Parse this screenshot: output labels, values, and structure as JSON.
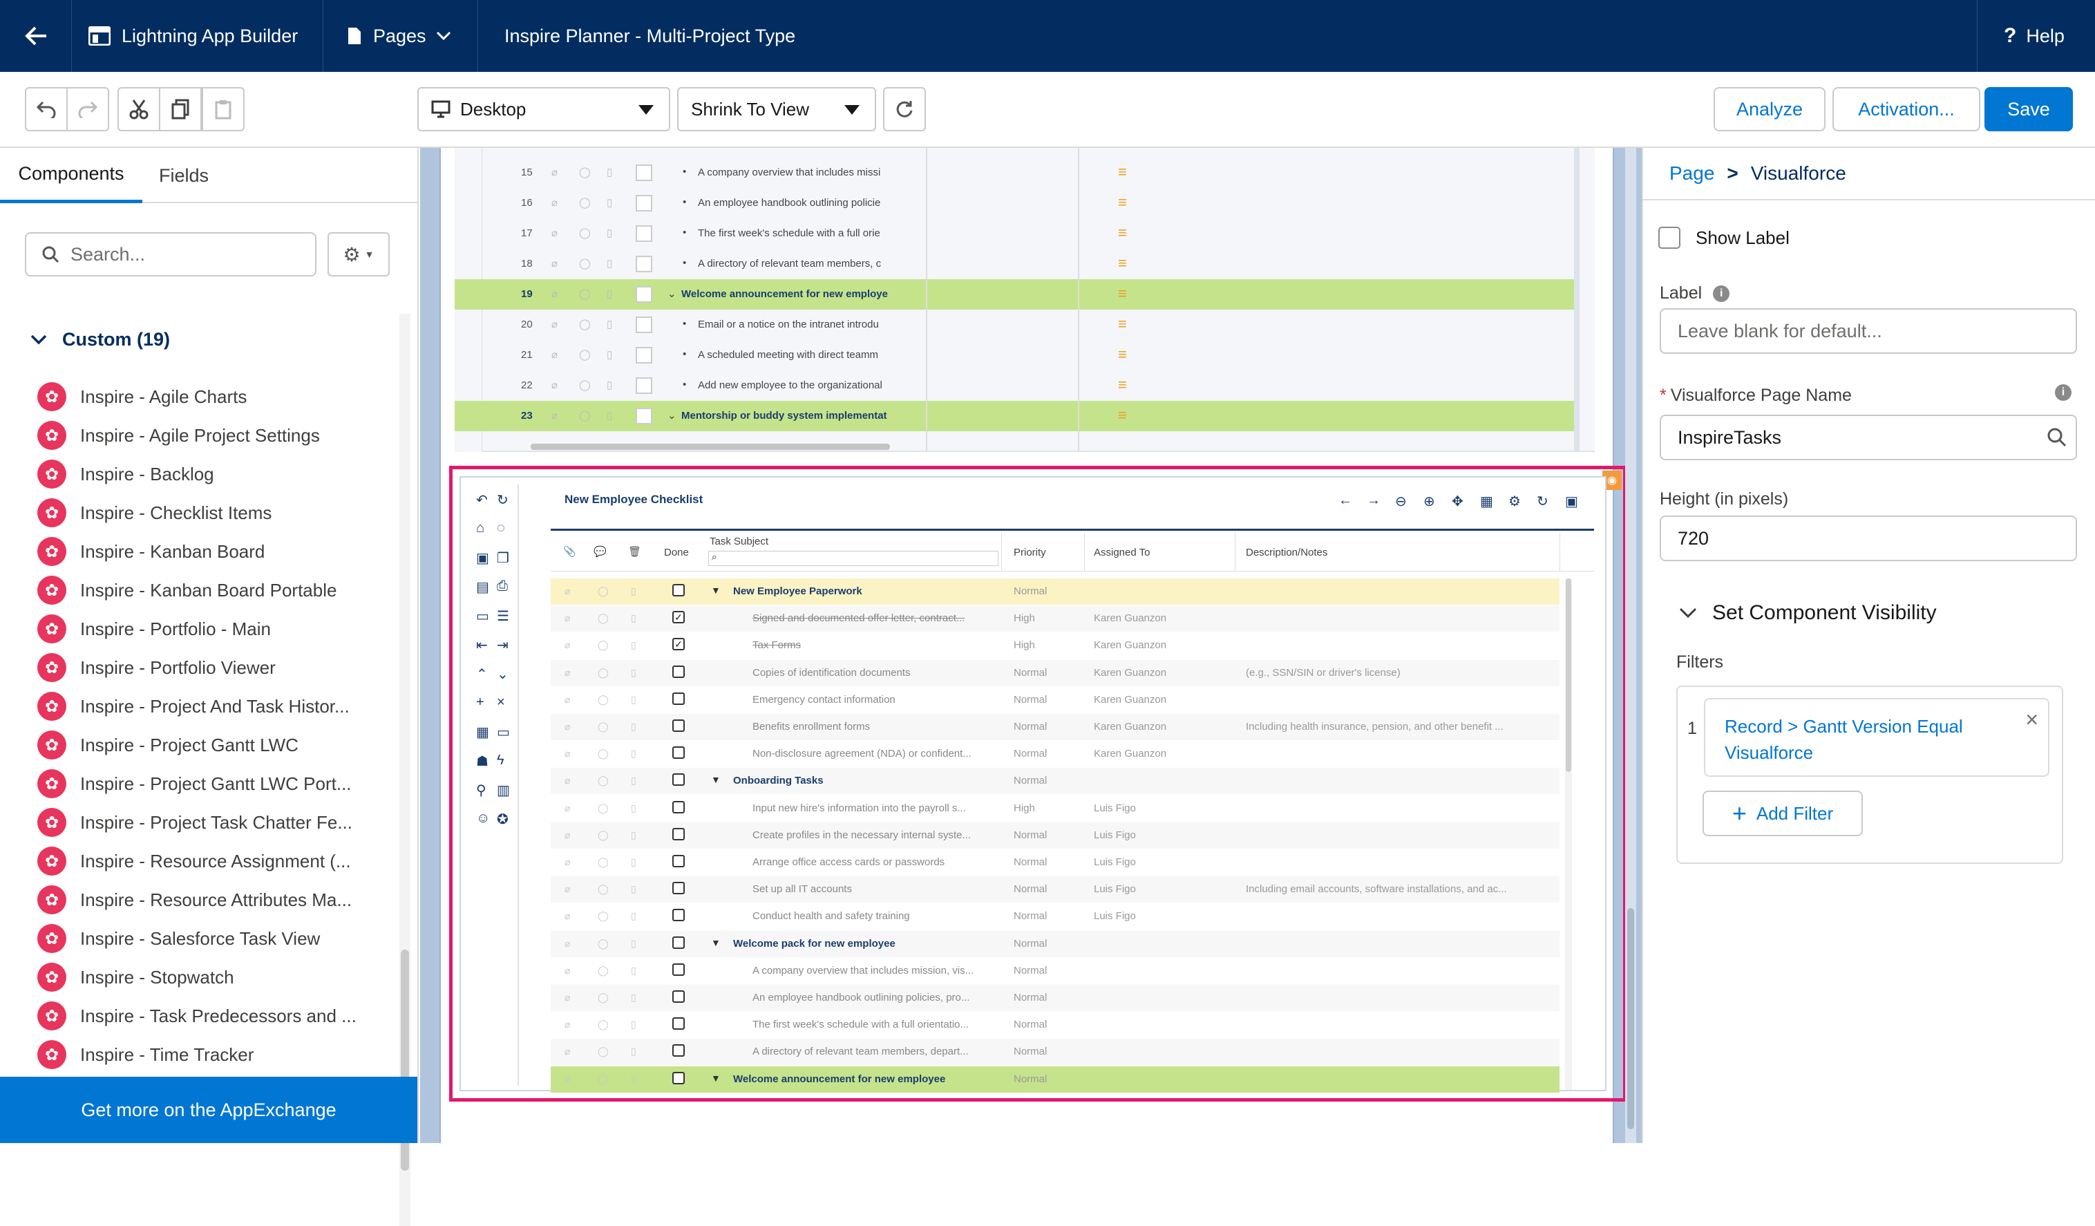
{
  "topbar": {
    "back_icon": "arrow-left-icon",
    "app_builder_label": "Lightning App Builder",
    "pages_label": "Pages",
    "page_title": "Inspire Planner - Multi-Project Type",
    "help_label": "Help"
  },
  "toolbar": {
    "device_select": "Desktop",
    "view_select": "Shrink To View",
    "analyze_label": "Analyze",
    "activation_label": "Activation...",
    "save_label": "Save"
  },
  "left_panel": {
    "tabs": [
      "Components",
      "Fields"
    ],
    "search_placeholder": "Search...",
    "section_title": "Custom (19)",
    "items": [
      "Inspire - Agile Charts",
      "Inspire - Agile Project Settings",
      "Inspire - Backlog",
      "Inspire - Checklist Items",
      "Inspire - Kanban Board",
      "Inspire - Kanban Board Portable",
      "Inspire - Portfolio - Main",
      "Inspire - Portfolio Viewer",
      "Inspire - Project And Task Histor...",
      "Inspire - Project Gantt LWC",
      "Inspire - Project Gantt LWC Port...",
      "Inspire - Project Task Chatter Fe...",
      "Inspire - Resource Assignment (...",
      "Inspire - Resource Attributes Ma...",
      "Inspire - Salesforce Task View",
      "Inspire - Stopwatch",
      "Inspire - Task Predecessors and ...",
      "Inspire - Time Tracker"
    ],
    "appexchange_label": "Get more on the AppExchange"
  },
  "upper_grid": {
    "rows": [
      {
        "num": "15",
        "text": "A company overview that includes missi",
        "kind": "child"
      },
      {
        "num": "16",
        "text": "An employee handbook outlining policie",
        "kind": "child"
      },
      {
        "num": "17",
        "text": "The first week's schedule with a full orie",
        "kind": "child"
      },
      {
        "num": "18",
        "text": "A directory of relevant team members, c",
        "kind": "child"
      },
      {
        "num": "19",
        "text": "Welcome announcement for new employe",
        "kind": "group"
      },
      {
        "num": "20",
        "text": "Email or a notice on the intranet introdu",
        "kind": "child"
      },
      {
        "num": "21",
        "text": "A scheduled meeting with direct teamm",
        "kind": "child"
      },
      {
        "num": "22",
        "text": "Add new employee to the organizational",
        "kind": "child"
      },
      {
        "num": "23",
        "text": "Mentorship or buddy system implementat",
        "kind": "group"
      }
    ]
  },
  "checklist": {
    "title": "New Employee Checklist",
    "columns": {
      "done": "Done",
      "subject": "Task Subject",
      "priority": "Priority",
      "assigned": "Assigned To",
      "description": "Description/Notes"
    },
    "rows": [
      {
        "subject": "New Employee Paperwork",
        "priority": "Normal",
        "assigned": "",
        "desc": "",
        "kind": "group-yellow",
        "done": false
      },
      {
        "subject": "Signed and documented offer letter, contract...",
        "priority": "High",
        "assigned": "Karen Guanzon",
        "desc": "",
        "kind": "strike",
        "done": true
      },
      {
        "subject": "Tax Forms",
        "priority": "High",
        "assigned": "Karen Guanzon",
        "desc": "",
        "kind": "strike",
        "done": true
      },
      {
        "subject": "Copies of identification documents",
        "priority": "Normal",
        "assigned": "Karen Guanzon",
        "desc": "(e.g., SSN/SIN or driver's license)",
        "kind": "child",
        "done": false
      },
      {
        "subject": "Emergency contact information",
        "priority": "Normal",
        "assigned": "Karen Guanzon",
        "desc": "",
        "kind": "child",
        "done": false
      },
      {
        "subject": "Benefits enrollment forms",
        "priority": "Normal",
        "assigned": "Karen Guanzon",
        "desc": "Including health insurance, pension, and other benefit ...",
        "kind": "child",
        "done": false
      },
      {
        "subject": "Non-disclosure agreement (NDA) or confident...",
        "priority": "Normal",
        "assigned": "Karen Guanzon",
        "desc": "",
        "kind": "child",
        "done": false
      },
      {
        "subject": "Onboarding Tasks",
        "priority": "Normal",
        "assigned": "",
        "desc": "",
        "kind": "group",
        "done": false
      },
      {
        "subject": "Input new hire's information into the payroll s...",
        "priority": "High",
        "assigned": "Luis Figo",
        "desc": "",
        "kind": "child",
        "done": false
      },
      {
        "subject": "Create profiles in the necessary internal syste...",
        "priority": "Normal",
        "assigned": "Luis Figo",
        "desc": "",
        "kind": "child",
        "done": false
      },
      {
        "subject": "Arrange office access cards or passwords",
        "priority": "Normal",
        "assigned": "Luis Figo",
        "desc": "",
        "kind": "child",
        "done": false
      },
      {
        "subject": "Set up all IT accounts",
        "priority": "Normal",
        "assigned": "Luis Figo",
        "desc": "Including email accounts, software installations, and ac...",
        "kind": "child",
        "done": false
      },
      {
        "subject": "Conduct health and safety training",
        "priority": "Normal",
        "assigned": "Luis Figo",
        "desc": "",
        "kind": "child",
        "done": false
      },
      {
        "subject": "Welcome pack for new employee",
        "priority": "Normal",
        "assigned": "",
        "desc": "",
        "kind": "group",
        "done": false
      },
      {
        "subject": "A company overview that includes mission, vis...",
        "priority": "Normal",
        "assigned": "",
        "desc": "",
        "kind": "child",
        "done": false
      },
      {
        "subject": "An employee handbook outlining policies, pro...",
        "priority": "Normal",
        "assigned": "",
        "desc": "",
        "kind": "child",
        "done": false
      },
      {
        "subject": "The first week's schedule with a full orientatio...",
        "priority": "Normal",
        "assigned": "",
        "desc": "",
        "kind": "child",
        "done": false
      },
      {
        "subject": "A directory of relevant team members, depart...",
        "priority": "Normal",
        "assigned": "",
        "desc": "",
        "kind": "child",
        "done": false
      },
      {
        "subject": "Welcome announcement for new employee",
        "priority": "Normal",
        "assigned": "",
        "desc": "",
        "kind": "group-green",
        "done": false
      }
    ]
  },
  "right_panel": {
    "breadcrumb_page": "Page",
    "breadcrumb_sep": ">",
    "breadcrumb_current": "Visualforce",
    "show_label": "Show Label",
    "label_title": "Label",
    "label_placeholder": "Leave blank for default...",
    "vf_required": "*",
    "vf_title": "Visualforce Page Name",
    "vf_value": "InspireTasks",
    "height_title": "Height (in pixels)",
    "height_value": "720",
    "visibility_title": "Set Component Visibility",
    "filters_title": "Filters",
    "filter_index": "1",
    "filter_text": "Record > Gantt Version Equal Visualforce",
    "add_filter_label": "Add Filter"
  },
  "colors": {
    "nav": "#032d60",
    "brand": "#0176d3",
    "highlight": "#e4176b",
    "group_green": "#c5e38b",
    "group_yellow": "#fbf3c4",
    "inspire_icon": "#e8355d"
  }
}
